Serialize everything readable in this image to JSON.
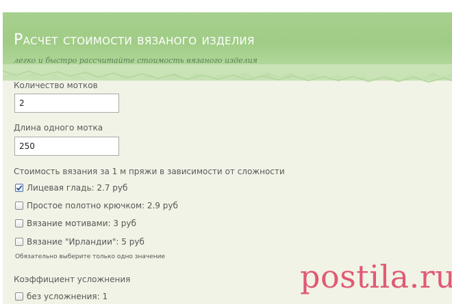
{
  "header": {
    "title": "Расчет стоимости вязаного изделия",
    "subtitle": "легко и быстро рассчитайте стоимость вязаного изделия"
  },
  "form": {
    "skeins": {
      "label": "Количество мотков",
      "value": "2"
    },
    "skein_length": {
      "label": "Длина одного мотка",
      "value": "250"
    },
    "pricing": {
      "label": "Стоимость вязания за 1 м пряжи в зависимости от сложности",
      "options": [
        {
          "label": "Лицевая гладь: 2.7 руб",
          "checked": true
        },
        {
          "label": "Простое полотно крючком: 2.9 руб",
          "checked": false
        },
        {
          "label": "Вязание мотивами: 3 руб",
          "checked": false
        },
        {
          "label": "Вязание \"Ирландии\": 5 руб",
          "checked": false
        }
      ],
      "note": "Обязательно выберите только одно значение"
    },
    "complexity": {
      "label": "Коэффициент усложнения",
      "options": [
        {
          "label": "без усложнения: 1",
          "checked": false
        }
      ]
    }
  },
  "watermark": "postila.ru",
  "colors": {
    "banner": "#a0cc86",
    "page_bg": "#f1f3e6",
    "watermark": "#e05a73"
  }
}
